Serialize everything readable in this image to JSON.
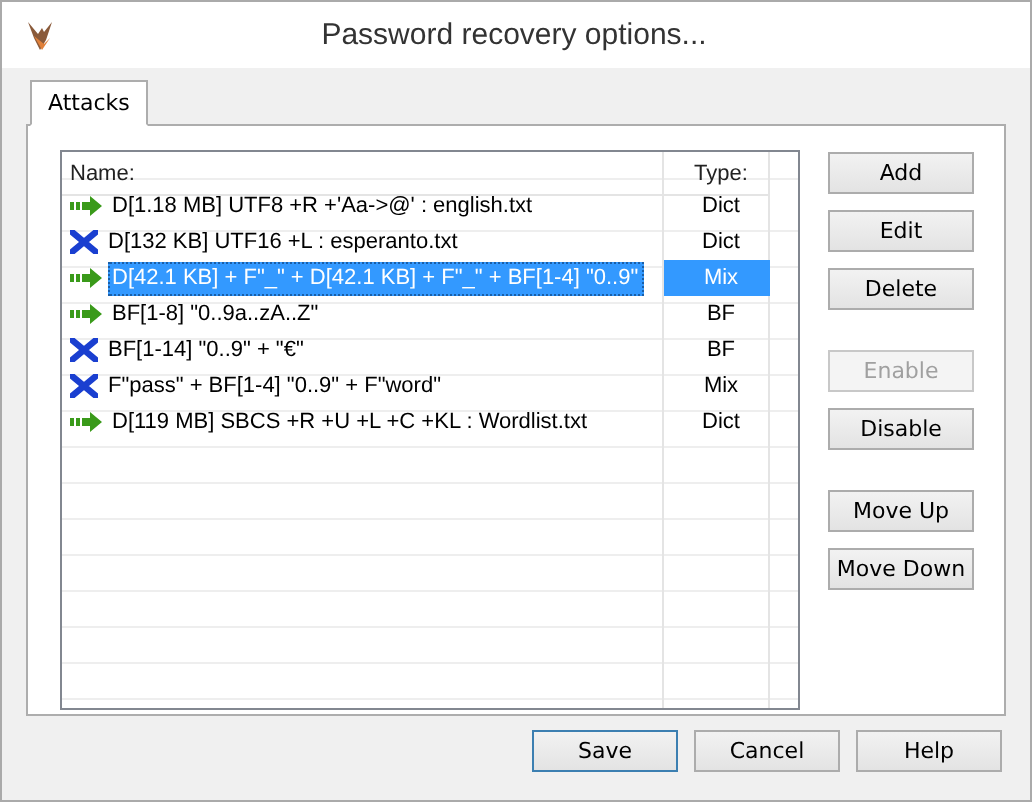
{
  "window": {
    "title": "Password recovery options..."
  },
  "tabs": [
    {
      "label": "Attacks",
      "selected": true
    }
  ],
  "table": {
    "columns": [
      "Name:",
      "Type:"
    ],
    "rows": [
      {
        "name": "D[1.18 MB]  UTF8 +R +'Aa->@' : english.txt",
        "type": "Dict",
        "enabled": true,
        "selected": false
      },
      {
        "name": "D[132 KB]  UTF16 +L : esperanto.txt",
        "type": "Dict",
        "enabled": false,
        "selected": false
      },
      {
        "name": "D[42.1 KB] + F\"_\" + D[42.1 KB] + F\"_\" + BF[1-4] \"0..9\"",
        "type": "Mix",
        "enabled": true,
        "selected": true
      },
      {
        "name": "BF[1-8] \"0..9a..zA..Z\"",
        "type": "BF",
        "enabled": true,
        "selected": false
      },
      {
        "name": "BF[1-14] \"0..9\" + \"€\"",
        "type": "BF",
        "enabled": false,
        "selected": false
      },
      {
        "name": "F\"pass\" + BF[1-4] \"0..9\" + F\"word\"",
        "type": "Mix",
        "enabled": false,
        "selected": false
      },
      {
        "name": "D[119 MB]  SBCS +R +U +L +C +KL : Wordlist.txt",
        "type": "Dict",
        "enabled": true,
        "selected": false
      }
    ]
  },
  "side_button_groups": [
    [
      {
        "label": "Add",
        "disabled": false
      },
      {
        "label": "Edit",
        "disabled": false
      },
      {
        "label": "Delete",
        "disabled": false
      }
    ],
    [
      {
        "label": "Enable",
        "disabled": true
      },
      {
        "label": "Disable",
        "disabled": false
      }
    ],
    [
      {
        "label": "Move Up",
        "disabled": false
      },
      {
        "label": "Move Down",
        "disabled": false
      }
    ]
  ],
  "footer_buttons": [
    {
      "label": "Save",
      "default": true
    },
    {
      "label": "Cancel",
      "default": false
    },
    {
      "label": "Help",
      "default": false
    }
  ]
}
